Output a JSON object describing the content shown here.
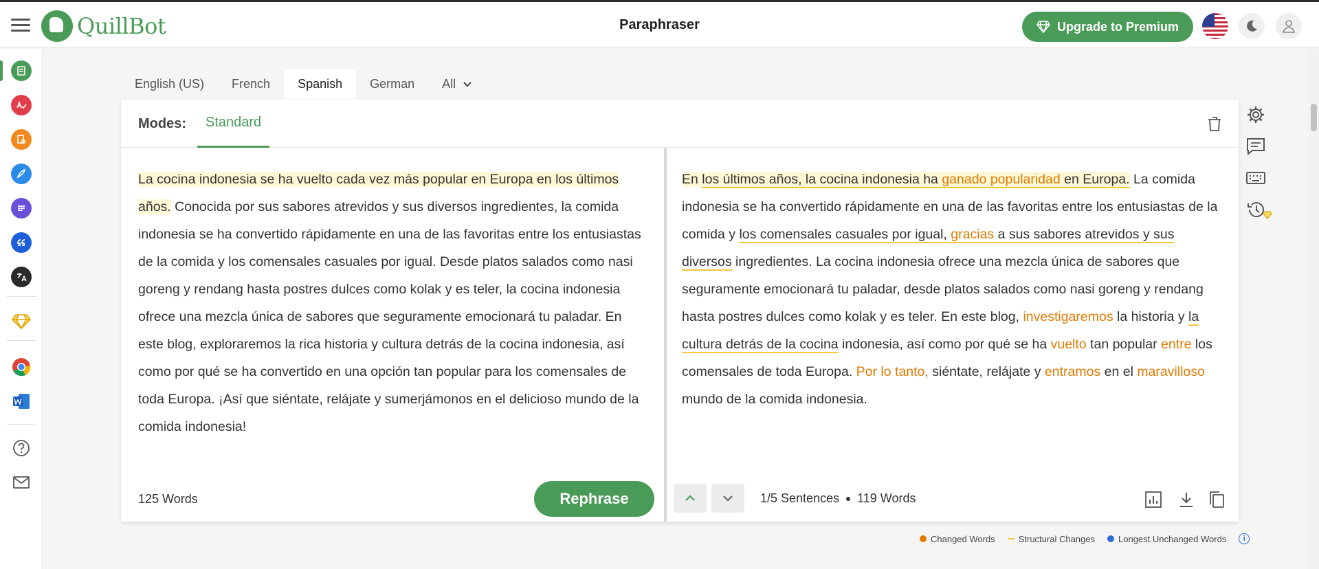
{
  "app": {
    "brand": "QuillBot",
    "page_title": "Paraphraser",
    "premium_label": "Upgrade to Premium"
  },
  "languages": {
    "tabs": [
      "English (US)",
      "French",
      "Spanish",
      "German",
      "All"
    ],
    "active": "Spanish"
  },
  "modes": {
    "label": "Modes:",
    "active": "Standard"
  },
  "input": {
    "segments": [
      {
        "text": "La cocina indonesia se ha vuelto cada vez más popular en Europa en los últimos años.",
        "highlight": true
      },
      {
        "text": " Conocida por sus sabores atrevidos y sus diversos ingredientes, la comida indonesia se ha convertido rápidamente en una de las favoritas entre los entusiastas de la comida y los comensales casuales por igual. Desde platos salados como nasi goreng y rendang hasta postres dulces como kolak y es teler, la cocina indonesia ofrece una mezcla única de sabores que seguramente emocionará tu paladar. En este blog, exploraremos la rica historia y cultura detrás de la cocina indonesia, así como por qué se ha convertido en una opción tan popular para los comensales de toda Europa. ¡Así que siéntate, relájate y sumerjámonos en el delicioso mundo de la comida indonesia!",
        "highlight": false
      }
    ],
    "word_count": "125 Words",
    "rephrase_label": "Rephrase"
  },
  "output": {
    "segments": [
      {
        "text": "En ",
        "type": "hl"
      },
      {
        "text": "los últimos años, la cocina indonesia ha ",
        "type": "hl-struct"
      },
      {
        "text": "ganado popularidad",
        "type": "hl-struct-chg"
      },
      {
        "text": " en Europa.",
        "type": "hl-struct"
      },
      {
        "text": " La comida indonesia se ha convertido rápidamente en una de las favoritas entre los entusiastas de la comida y ",
        "type": "plain"
      },
      {
        "text": "los comensales casuales por igual, ",
        "type": "struct"
      },
      {
        "text": "gracias",
        "type": "struct-chg"
      },
      {
        "text": " a sus sabores atrevidos y sus diversos",
        "type": "struct"
      },
      {
        "text": " ingredientes. La cocina indonesia ofrece una mezcla única de sabores que seguramente emocionará tu paladar, desde platos salados como nasi goreng y rendang hasta postres dulces como kolak y es teler. En este blog, ",
        "type": "plain"
      },
      {
        "text": "investigaremos",
        "type": "chg"
      },
      {
        "text": " la historia y ",
        "type": "plain"
      },
      {
        "text": "la cultura detrás de la cocina",
        "type": "struct"
      },
      {
        "text": " indonesia, así como por qué se ha ",
        "type": "plain"
      },
      {
        "text": "vuelto",
        "type": "chg"
      },
      {
        "text": " tan popular ",
        "type": "plain"
      },
      {
        "text": "entre",
        "type": "chg"
      },
      {
        "text": " los comensales de toda Europa. ",
        "type": "plain"
      },
      {
        "text": "Por lo tanto,",
        "type": "chg"
      },
      {
        "text": " siéntate, relájate y ",
        "type": "plain"
      },
      {
        "text": "entramos",
        "type": "chg"
      },
      {
        "text": " en el ",
        "type": "plain"
      },
      {
        "text": "maravilloso",
        "type": "chg"
      },
      {
        "text": " mundo de la comida indonesia.",
        "type": "plain"
      }
    ],
    "sentence_info": "1/5 Sentences",
    "word_count": "119 Words"
  },
  "legend": {
    "changed": "Changed Words",
    "structural": "Structural Changes",
    "unchanged": "Longest Unchanged Words"
  },
  "colors": {
    "brand_green": "#4a9b57",
    "changed_orange": "#e07a00",
    "structural_yellow": "#f5c93a",
    "unchanged_blue": "#2a6ed8"
  },
  "icons": {
    "sidebar": [
      "paraphraser-icon",
      "grammar-checker-icon",
      "plagiarism-checker-icon",
      "co-writer-icon",
      "summarizer-icon",
      "citation-generator-icon",
      "translator-icon",
      "premium-diamond-icon",
      "chrome-extension-icon",
      "word-addin-icon",
      "help-icon",
      "mail-icon"
    ]
  }
}
